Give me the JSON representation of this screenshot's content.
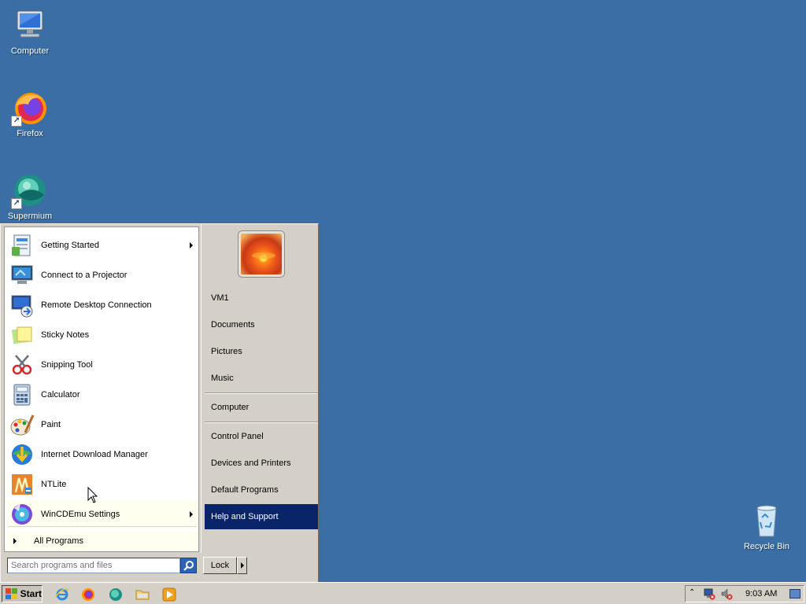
{
  "desktop": {
    "icons": [
      {
        "label": "Computer"
      },
      {
        "label": "Firefox"
      },
      {
        "label": "Supermium"
      },
      {
        "label": "Recycle Bin"
      }
    ]
  },
  "start_menu": {
    "programs": [
      {
        "label": "Getting Started",
        "icon": "getting-started-icon",
        "has_submenu": true
      },
      {
        "label": "Connect to a Projector",
        "icon": "projector-icon",
        "has_submenu": false
      },
      {
        "label": "Remote Desktop Connection",
        "icon": "remote-desktop-icon",
        "has_submenu": false
      },
      {
        "label": "Sticky Notes",
        "icon": "sticky-notes-icon",
        "has_submenu": false
      },
      {
        "label": "Snipping Tool",
        "icon": "snipping-tool-icon",
        "has_submenu": false
      },
      {
        "label": "Calculator",
        "icon": "calculator-icon",
        "has_submenu": false
      },
      {
        "label": "Paint",
        "icon": "paint-icon",
        "has_submenu": false
      },
      {
        "label": "Internet Download Manager",
        "icon": "idm-icon",
        "has_submenu": false
      },
      {
        "label": "NTLite",
        "icon": "ntlite-icon",
        "has_submenu": false
      },
      {
        "label": "WinCDEmu Settings",
        "icon": "wincdemu-icon",
        "has_submenu": true
      }
    ],
    "all_programs": "All Programs",
    "right_items": [
      {
        "label": "VM1"
      },
      {
        "label": "Documents"
      },
      {
        "label": "Pictures"
      },
      {
        "label": "Music"
      },
      {
        "label": "Computer"
      },
      {
        "label": "Control Panel"
      },
      {
        "label": "Devices and Printers"
      },
      {
        "label": "Default Programs"
      },
      {
        "label": "Help and Support",
        "selected": true
      }
    ],
    "search": {
      "placeholder": "Search programs and files",
      "value": ""
    },
    "lock_label": "Lock"
  },
  "taskbar": {
    "start_label": "Start",
    "quick_launch": [
      "internet-explorer-icon",
      "firefox-icon",
      "supermium-icon",
      "explorer-folder-icon",
      "media-player-icon"
    ],
    "tray_icons": [
      "network-icon",
      "volume-muted-icon"
    ],
    "clock": "9:03 AM"
  },
  "colors": {
    "desktop": "#3a6ea5",
    "selection": "#0a246a",
    "menu_face": "#d4d0c8"
  }
}
